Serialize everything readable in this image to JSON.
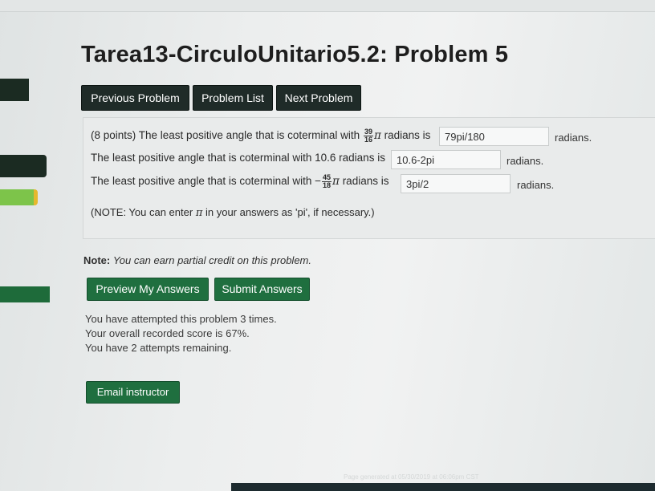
{
  "page": {
    "title": "Tarea13-CirculoUnitario5.2: Problem 5"
  },
  "nav": {
    "previous": "Previous Problem",
    "list": "Problem List",
    "next": "Next Problem"
  },
  "problem": {
    "line1_prefix": "(8 points) The least positive angle that is coterminal with",
    "line1_num": "39",
    "line1_den": "16",
    "line1_suffix": "radians is",
    "answer1": "79pi/180",
    "unit1": "radians.",
    "line2_text": "The least positive angle that is coterminal with 10.6 radians is",
    "answer2": "10.6-2pi",
    "unit2": "radians.",
    "line3_prefix": "The least positive angle that is coterminal with −",
    "line3_num": "45",
    "line3_den": "18",
    "line3_suffix": "radians is",
    "answer3": "3pi/2",
    "unit3": "radians.",
    "pi_symbol": "π",
    "note_prefix": "(NOTE: You can enter",
    "note_suffix": "in your answers as 'pi', if necessary.)"
  },
  "note": {
    "label": "Note:",
    "text": "You can earn partial credit on this problem."
  },
  "actions": {
    "preview": "Preview My Answers",
    "submit": "Submit Answers",
    "email": "Email instructor"
  },
  "status": {
    "attempts": "You have attempted this problem 3 times.",
    "score": "Your overall recorded score is 67%.",
    "remaining": "You have 2 attempts remaining."
  },
  "footer": {
    "generated": "Page generated at 05/30/2019 at 06:06pm CST"
  },
  "colors": {
    "nav_button": "#1f2b28",
    "action_button": "#1f6f3f",
    "problem_box": "#e9ebeb"
  }
}
